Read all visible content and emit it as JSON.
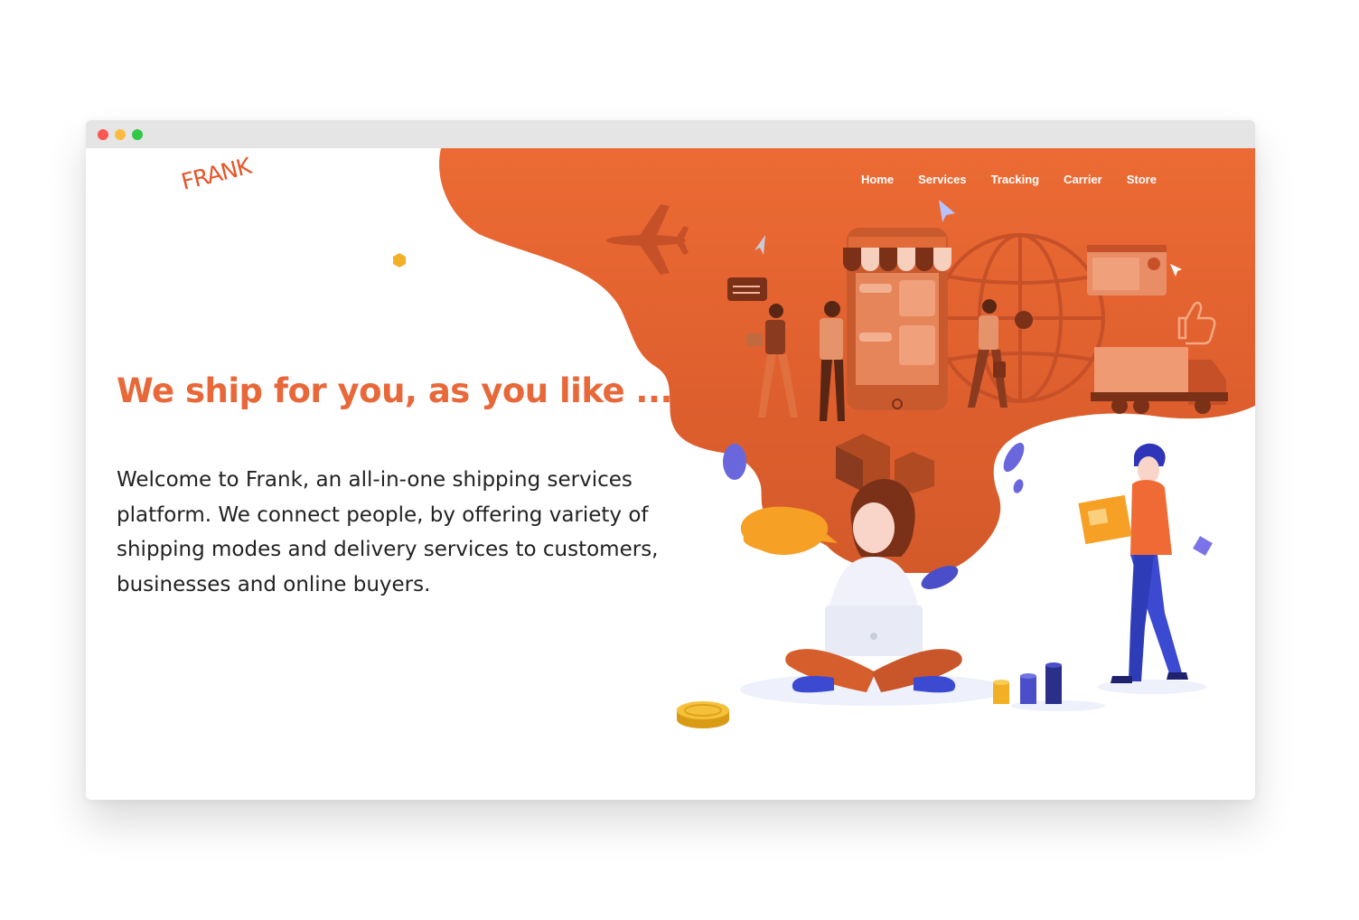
{
  "brand": {
    "logo_text": "FRANK",
    "accent_color": "#e8683a"
  },
  "nav": {
    "items": [
      {
        "label": "Home"
      },
      {
        "label": "Services"
      },
      {
        "label": "Tracking"
      },
      {
        "label": "Carrier"
      },
      {
        "label": "Store"
      }
    ]
  },
  "hero": {
    "headline": "We ship for you, as you like ...",
    "intro": "Welcome to Frank, an all-in-one shipping services platform. We connect people, by offering variety of shipping modes and delivery services to customers, businesses and online buyers."
  },
  "illustration": {
    "icons": [
      "airplane-icon",
      "storefront-phone",
      "globe-icon",
      "delivery-truck-icon",
      "thumbs-up-icon",
      "coin-icon",
      "package-box-icon"
    ]
  }
}
